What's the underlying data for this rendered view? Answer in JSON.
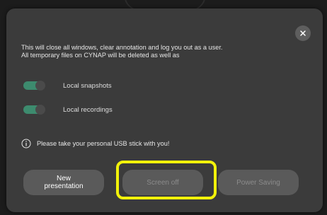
{
  "dialog": {
    "message_line1": "This will close all windows, clear annotation and log you out as a user.",
    "message_line2": "All temporary files on CYNAP will be deleted as well as",
    "options": [
      {
        "label": "Local snapshots",
        "enabled": true
      },
      {
        "label": "Local recordings",
        "enabled": true
      }
    ],
    "info_text": "Please take your personal USB stick with you!",
    "buttons": {
      "new_presentation_line1": "New",
      "new_presentation_line2": "presentation",
      "screen_off": "Screen off",
      "power_saving": "Power Saving"
    },
    "close_icon": "close-icon",
    "info_icon": "info-icon"
  },
  "colors": {
    "toggle_on": "#3d8b6e",
    "dialog_bg": "#3b3b3b",
    "button_bg": "#5a5a5a",
    "highlight": "#f2f20a"
  }
}
